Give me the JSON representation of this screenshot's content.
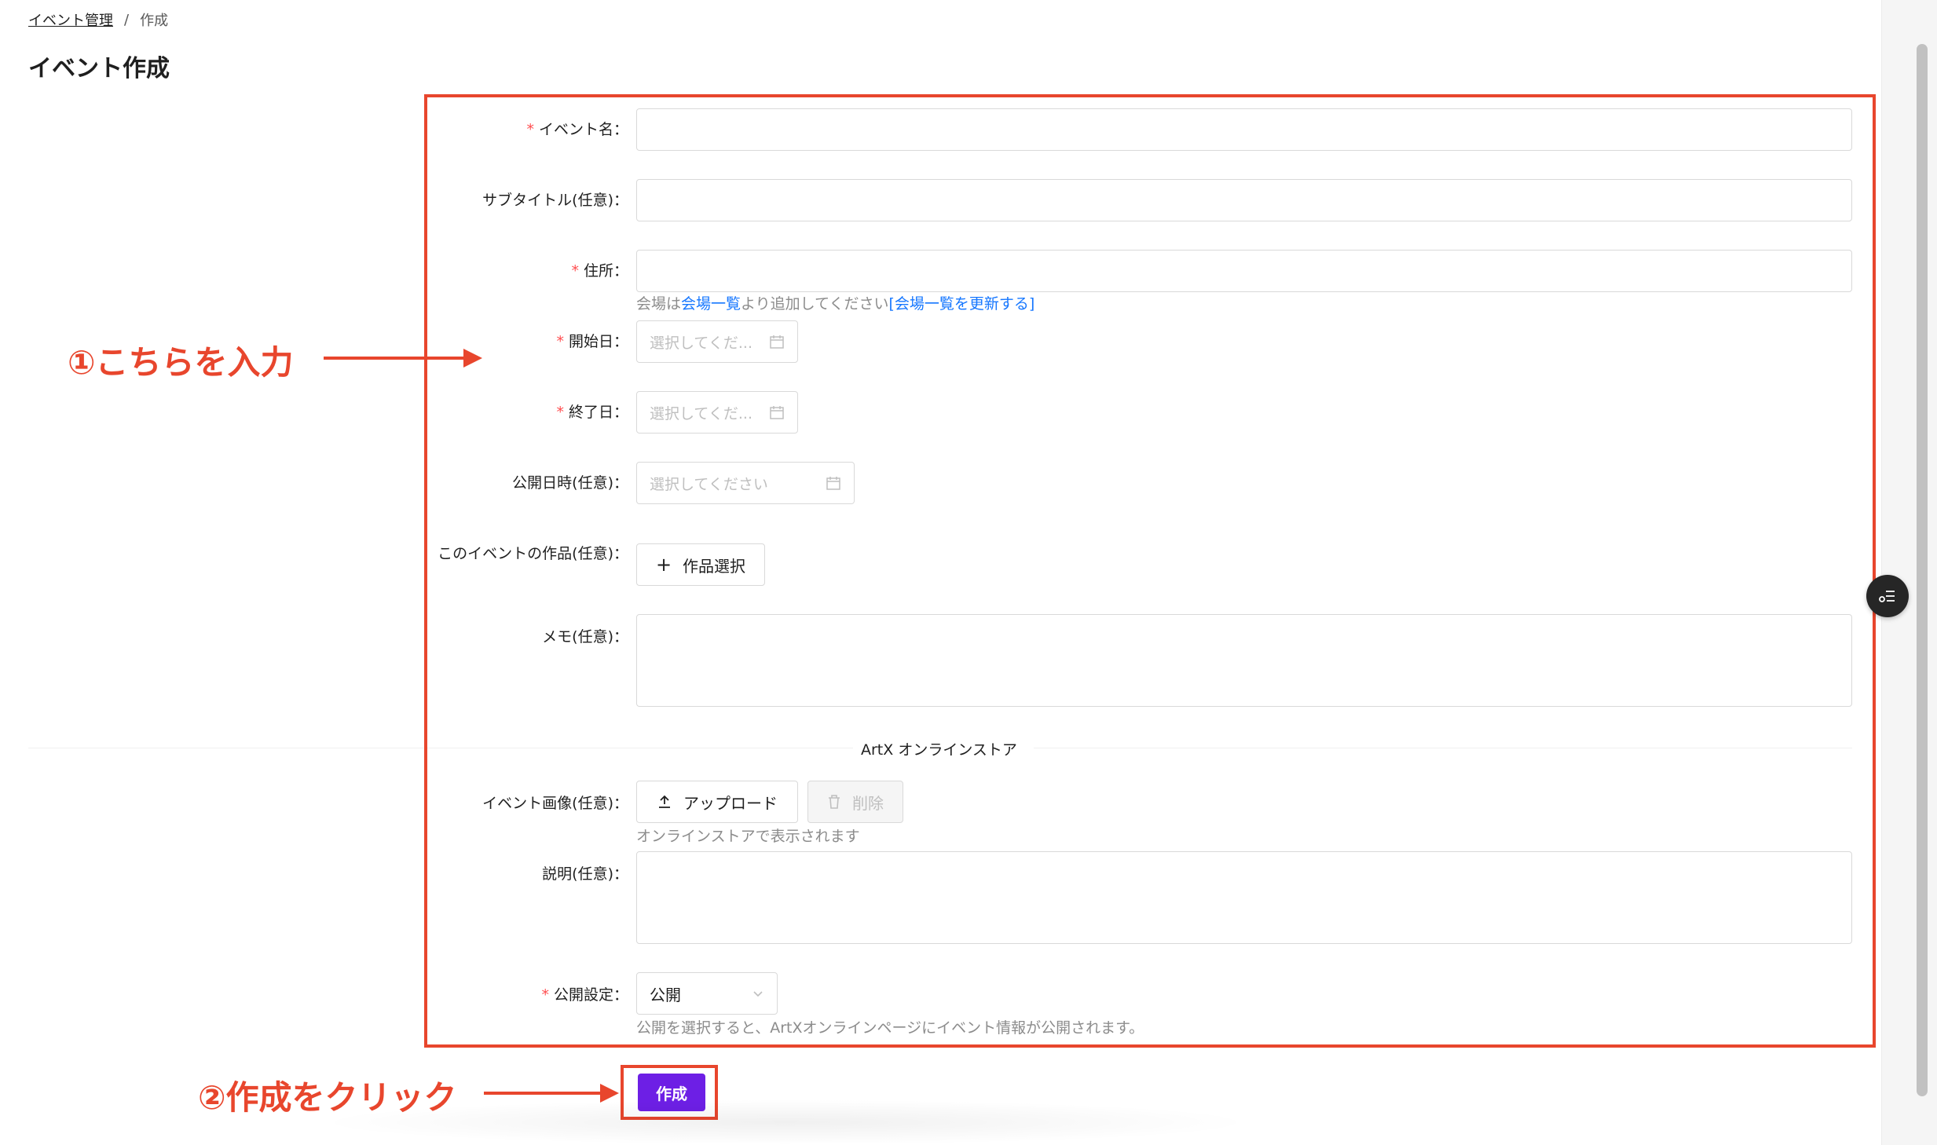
{
  "breadcrumb": {
    "parent": "イベント管理",
    "separator": "/",
    "current": "作成"
  },
  "page_title": "イベント作成",
  "form": {
    "event_name": {
      "label": "イベント名",
      "required": true,
      "value": ""
    },
    "subtitle": {
      "label": "サブタイトル(任意)",
      "value": ""
    },
    "address": {
      "label": "住所",
      "required": true,
      "value": "",
      "help_prefix": "会場は",
      "help_link": "会場一覧",
      "help_middle": "より追加してください",
      "help_refresh": "[会場一覧を更新する]"
    },
    "start_date": {
      "label": "開始日",
      "required": true,
      "placeholder": "選択してくだ..."
    },
    "end_date": {
      "label": "終了日",
      "required": true,
      "placeholder": "選択してくだ..."
    },
    "publish_datetime": {
      "label": "公開日時(任意)",
      "placeholder": "選択してください"
    },
    "works": {
      "label": "このイベントの作品(任意)",
      "button": "作品選択"
    },
    "memo": {
      "label": "メモ(任意)",
      "value": ""
    },
    "section_title": "ArtX オンラインストア",
    "event_image": {
      "label": "イベント画像(任意)",
      "upload_button": "アップロード",
      "delete_button": "削除",
      "help": "オンラインストアで表示されます"
    },
    "description": {
      "label": "説明(任意)",
      "value": ""
    },
    "publish_setting": {
      "label": "公開設定",
      "required": true,
      "selected": "公開",
      "help": "公開を選択すると、ArtXオンラインページにイベント情報が公開されます。"
    },
    "submit": "作成"
  },
  "annotations": {
    "step1": "①こちらを入力",
    "step2": "②作成をクリック",
    "color": "#e8462d"
  },
  "colors": {
    "primary": "#6d1fe5",
    "required": "#ff4d4f",
    "link": "#1677ff"
  }
}
